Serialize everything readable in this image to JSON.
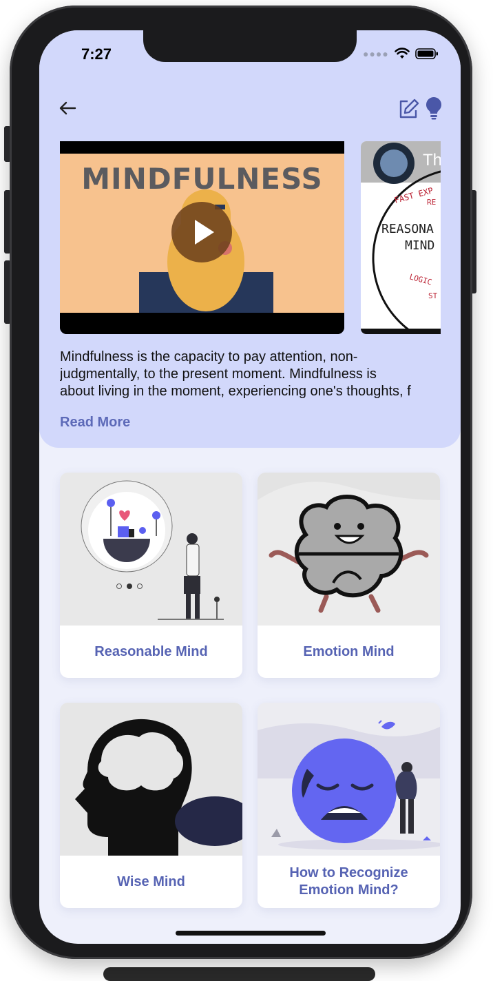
{
  "status_bar": {
    "time": "7:27"
  },
  "header": {
    "video_title": "MINDFULNESS",
    "second_video_top": "Th",
    "second_video_label_1": "REASONA",
    "second_video_label_2": "MIND"
  },
  "description_lines": [
    "Mindfulness is the capacity to pay attention, non-",
    "judgmentally, to the present moment. Mindfulness is",
    "about living in the moment, experiencing one's thoughts, f"
  ],
  "read_more": "Read More",
  "cards": [
    {
      "label": "Reasonable Mind"
    },
    {
      "label": "Emotion Mind"
    },
    {
      "label": "Wise Mind"
    },
    {
      "label": "How to Recognize Emotion Mind?"
    }
  ],
  "colors": {
    "header_bg": "#d2d8fb",
    "accent": "#5663b3",
    "page_bg": "#eef0fb",
    "emoji_blue": "#6366f1"
  }
}
